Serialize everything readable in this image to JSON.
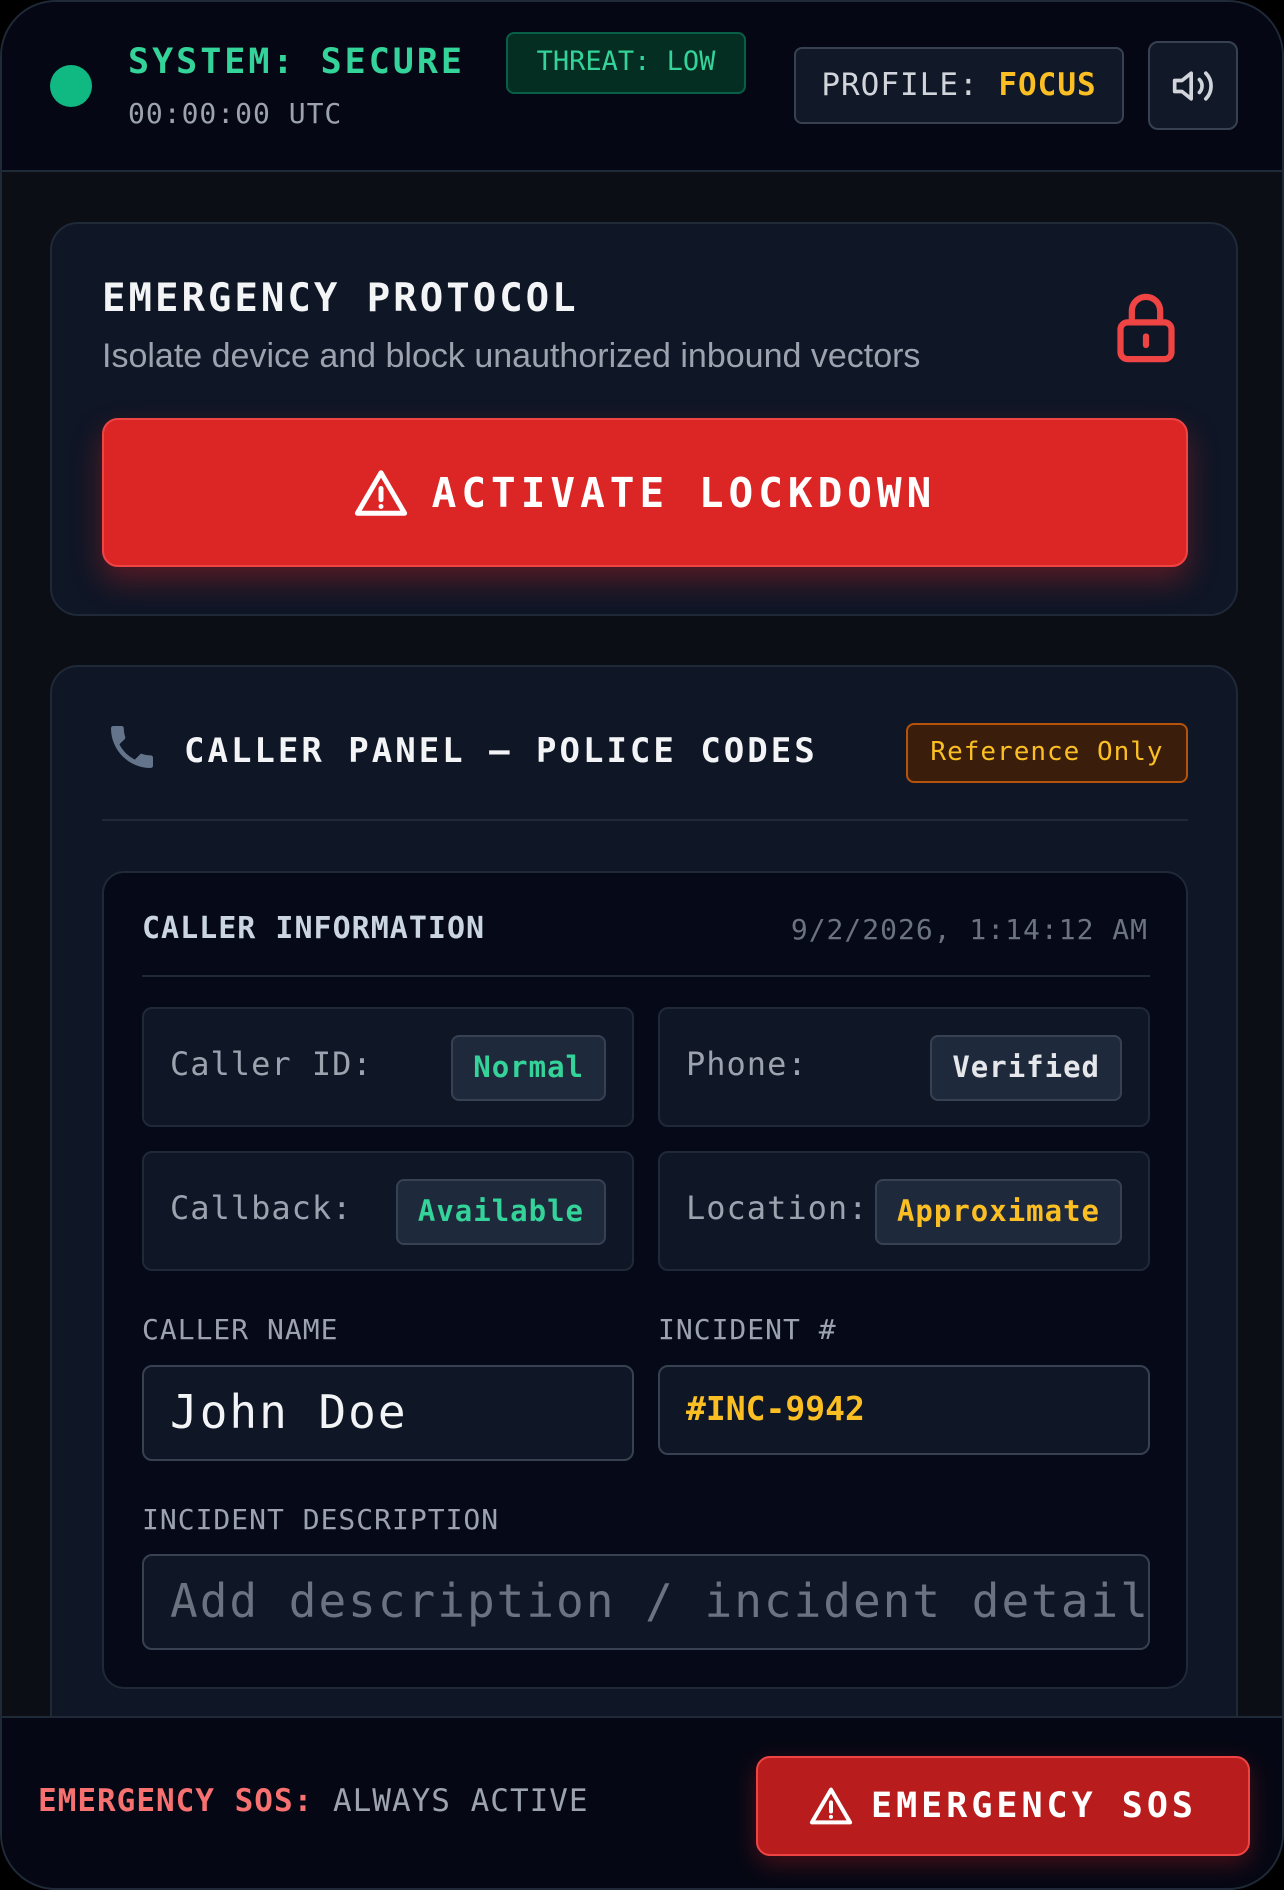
{
  "header": {
    "system_status": "SYSTEM: SECURE",
    "clock": "00:00:00 UTC",
    "threat": "THREAT: LOW",
    "profile_label": "PROFILE: ",
    "profile_value": "FOCUS",
    "sound_icon": "speaker-icon"
  },
  "emergency_protocol": {
    "title": "EMERGENCY PROTOCOL",
    "subtitle": "Isolate device and block unauthorized inbound vectors",
    "lock_icon": "lock-icon",
    "button_label": "ACTIVATE LOCKDOWN",
    "button_icon": "warning-triangle-icon"
  },
  "caller_panel": {
    "title": "CALLER PANEL — POLICE CODES",
    "badge": "Reference Only",
    "phone_icon": "telephone-icon",
    "info": {
      "title": "CALLER INFORMATION",
      "timestamp": "9/2/2026, 1:14:12 AM",
      "fields": [
        {
          "label": "Caller ID:",
          "status": "Normal"
        },
        {
          "label": "Phone:",
          "status": "Verified"
        },
        {
          "label": "Callback:",
          "status": "Available"
        },
        {
          "label": "Location:",
          "status": "Approximate"
        }
      ]
    },
    "caller_name_label": "CALLER NAME",
    "caller_name_value": "John Doe",
    "incident_label": "INCIDENT #",
    "incident_value": "#INC-9942",
    "description_label": "INCIDENT DESCRIPTION",
    "description_placeholder": "Add description / incident detail"
  },
  "footer": {
    "sos_key": "EMERGENCY SOS:",
    "sos_value": "ALWAYS ACTIVE",
    "sos_button": "EMERGENCY SOS"
  },
  "colors": {
    "accent_green": "#10b981",
    "danger_red": "#dc2626",
    "warning_yellow": "#fbbf24",
    "background": "#0b0e14"
  }
}
